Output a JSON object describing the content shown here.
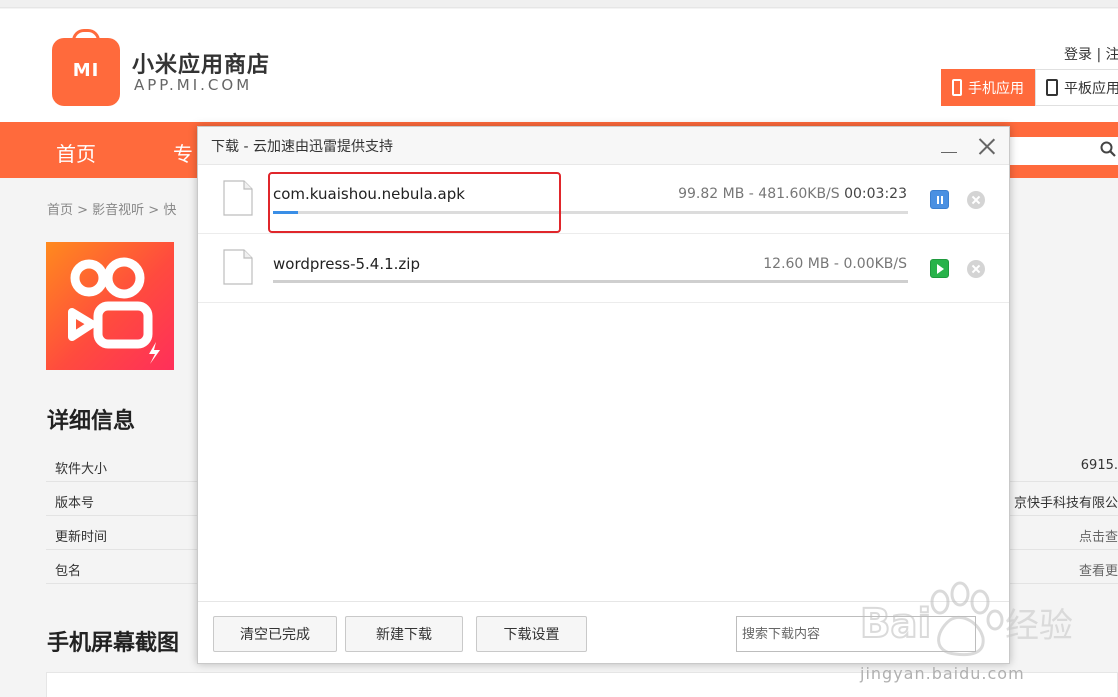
{
  "store": {
    "logo_text": "MI",
    "name": "小米应用商店",
    "url": "APP.MI.COM",
    "auth": "登录 | 注",
    "device_tabs": [
      {
        "label": "手机应用",
        "active": true
      },
      {
        "label": "平板应用",
        "active": false
      }
    ],
    "nav": [
      "首页",
      "专"
    ],
    "breadcrumb": "首页  >  影音视听  >  快",
    "detail_title": "详细信息",
    "detail_rows": [
      {
        "key": "软件大小",
        "value": "6915."
      },
      {
        "key": "版本号",
        "value": "京快手科技有限公"
      },
      {
        "key": "更新时间",
        "value": "点击查"
      },
      {
        "key": "包名",
        "value": "查看更"
      }
    ],
    "screenshots_title": "手机屏幕截图"
  },
  "dialog": {
    "title": "下载 - 云加速由迅雷提供支持",
    "items": [
      {
        "filename": "com.kuaishou.nebula.apk",
        "size": "99.82 MB",
        "speed": "481.60KB/S",
        "time": "00:03:23",
        "progress": 0.04,
        "state": "downloading"
      },
      {
        "filename": "wordpress-5.4.1.zip",
        "size": "12.60 MB",
        "speed": "0.00KB/S",
        "time": "",
        "progress": 1.0,
        "state": "paused"
      }
    ],
    "footer": {
      "clear_label": "清空已完成",
      "new_label": "新建下载",
      "settings_label": "下载设置",
      "search_placeholder": "搜索下载内容"
    }
  },
  "watermark": {
    "brand": "Bai du 经验",
    "url": "jingyan.baidu.com"
  },
  "colors": {
    "accent": "#ff6a3c",
    "progress": "#3a8ee6",
    "pause": "#4a90e2",
    "play": "#28b34a",
    "highlight": "#e0262b"
  }
}
